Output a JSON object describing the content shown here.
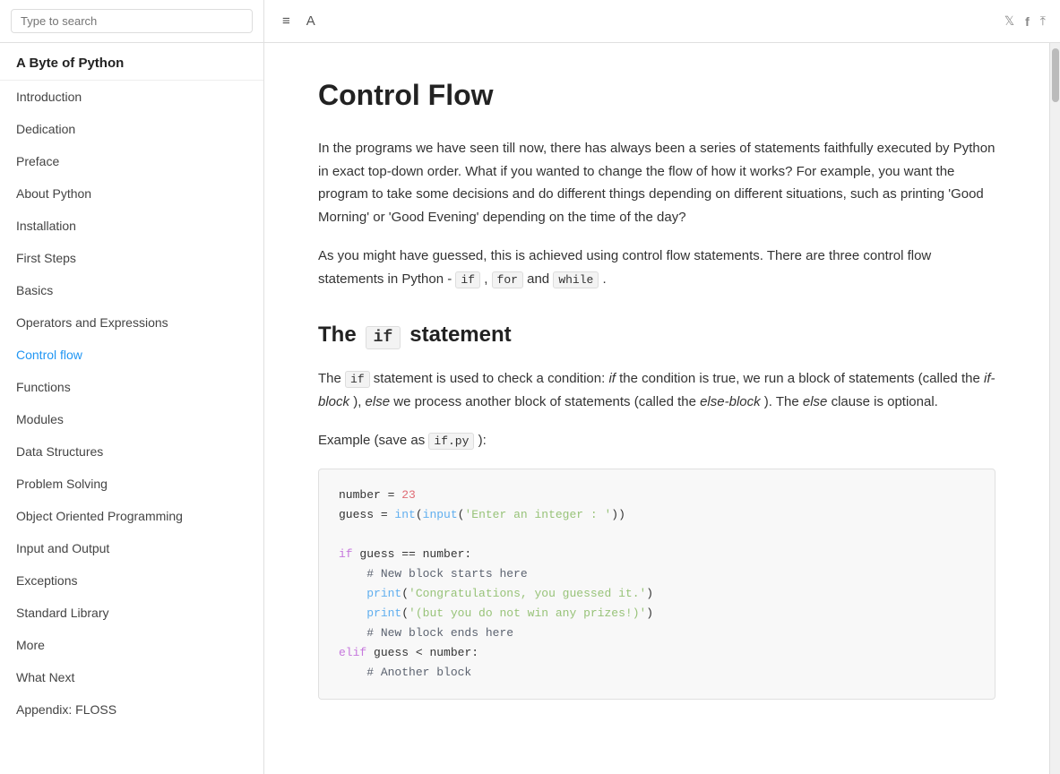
{
  "app": {
    "title": "A Byte of Python"
  },
  "search": {
    "placeholder": "Type to search"
  },
  "toolbar": {
    "list_icon": "≡",
    "font_icon": "A",
    "twitter_icon": "𝕏",
    "facebook_icon": "f",
    "share_icon": "⬆"
  },
  "sidebar": {
    "title": "A Byte of Python",
    "items": [
      {
        "id": "introduction",
        "label": "Introduction",
        "active": false
      },
      {
        "id": "dedication",
        "label": "Dedication",
        "active": false
      },
      {
        "id": "preface",
        "label": "Preface",
        "active": false
      },
      {
        "id": "about-python",
        "label": "About Python",
        "active": false
      },
      {
        "id": "installation",
        "label": "Installation",
        "active": false
      },
      {
        "id": "first-steps",
        "label": "First Steps",
        "active": false
      },
      {
        "id": "basics",
        "label": "Basics",
        "active": false
      },
      {
        "id": "operators-and-expressions",
        "label": "Operators and Expressions",
        "active": false
      },
      {
        "id": "control-flow",
        "label": "Control flow",
        "active": true
      },
      {
        "id": "functions",
        "label": "Functions",
        "active": false
      },
      {
        "id": "modules",
        "label": "Modules",
        "active": false
      },
      {
        "id": "data-structures",
        "label": "Data Structures",
        "active": false
      },
      {
        "id": "problem-solving",
        "label": "Problem Solving",
        "active": false
      },
      {
        "id": "object-oriented-programming",
        "label": "Object Oriented Programming",
        "active": false
      },
      {
        "id": "input-and-output",
        "label": "Input and Output",
        "active": false
      },
      {
        "id": "exceptions",
        "label": "Exceptions",
        "active": false
      },
      {
        "id": "standard-library",
        "label": "Standard Library",
        "active": false
      },
      {
        "id": "more",
        "label": "More",
        "active": false
      },
      {
        "id": "what-next",
        "label": "What Next",
        "active": false
      },
      {
        "id": "appendix-floss",
        "label": "Appendix: FLOSS",
        "active": false
      }
    ]
  },
  "content": {
    "page_title": "Control Flow",
    "intro_para1": "In the programs we have seen till now, there has always been a series of statements faithfully executed by Python in exact top-down order. What if you wanted to change the flow of how it works? For example, you want the program to take some decisions and do different things depending on different situations, such as printing 'Good Morning' or 'Good Evening' depending on the time of the day?",
    "intro_para2_before": "As you might have guessed, this is achieved using control flow statements. There are three control flow statements in Python -",
    "intro_para2_if": "if",
    "intro_para2_comma": ",",
    "intro_para2_for": "for",
    "intro_para2_and": "and",
    "intro_para2_while": "while",
    "intro_para2_dot": ".",
    "section1_title_prefix": "The",
    "section1_title_if": "if",
    "section1_title_suffix": "statement",
    "section1_para1_before": "The",
    "section1_para1_if": "if",
    "section1_para1_after": "statement is used to check a condition:",
    "section1_para1_if_italic": "if",
    "section1_para1_middle": "the condition is true, we run a block of statements (called the",
    "section1_para1_ifblock": "if-block",
    "section1_para1_else_italic": "else",
    "section1_para1_elsetext": "we process another block of statements (called the",
    "section1_para1_elseblock": "else-block",
    "section1_para1_end": "). The",
    "section1_para1_else2": "else",
    "section1_para1_final": "clause is optional.",
    "example_label": "Example (save as",
    "example_file": "if.py",
    "example_label_end": "):",
    "code_lines": [
      "number = 23",
      "guess = int(input('Enter an integer : '))",
      "",
      "if guess == number:",
      "    # New block starts here",
      "    print('Congratulations, you guessed it.')",
      "    print('(but you do not win any prizes!)')",
      "    # New block ends here",
      "elif guess < number:",
      "    # Another block"
    ]
  }
}
